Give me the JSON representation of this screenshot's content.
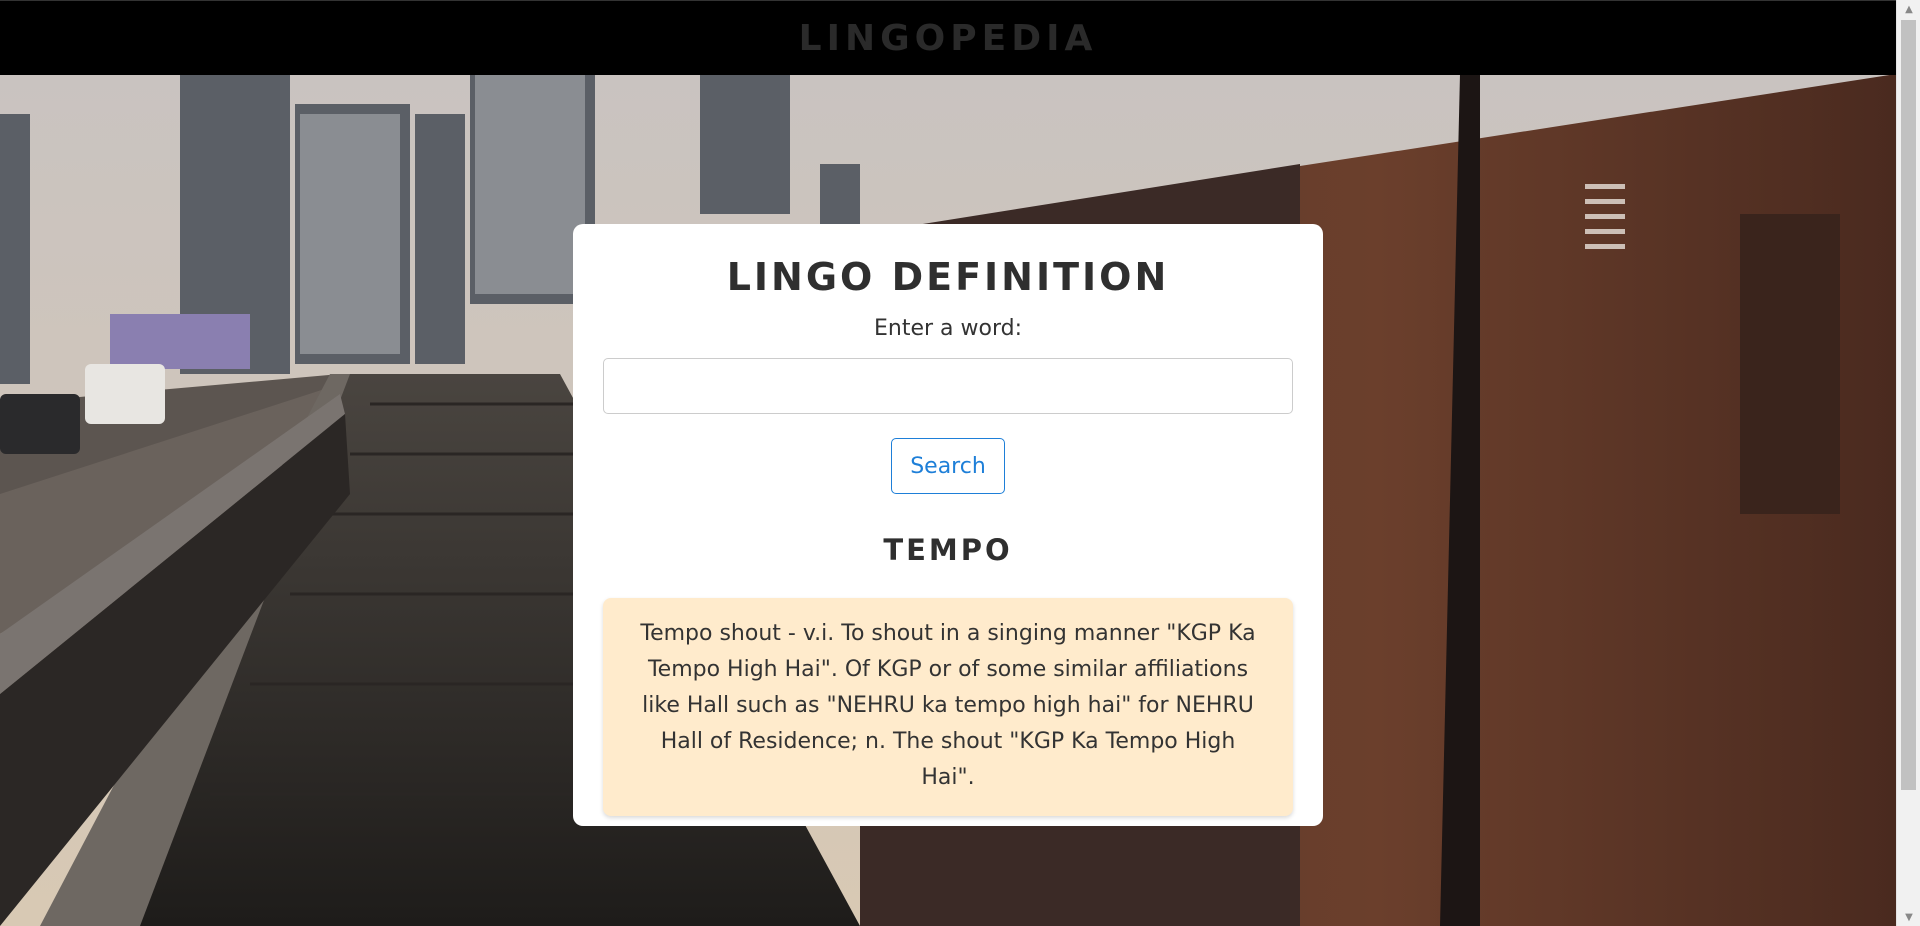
{
  "header": {
    "brand": "LINGOPEDIA"
  },
  "card": {
    "title": "LINGO DEFINITION",
    "input_label": "Enter a word:",
    "input_value": "",
    "search_label": "Search",
    "result_word": "TEMPO",
    "definition": "Tempo shout - v.i. To shout in a singing manner \"KGP Ka Tempo High Hai\". Of KGP or of some similar affiliations like Hall such as \"NEHRU ka tempo high hai\" for NEHRU Hall of Residence; n. The shout \"KGP Ka Tempo High Hai\"."
  },
  "colors": {
    "header_bg": "#000000",
    "brand_text": "#2a2a2a",
    "button_accent": "#1e7fd8",
    "definition_bg": "#ffebcc"
  },
  "icons": {
    "scroll_up": "triangle-up",
    "scroll_down": "triangle-down"
  }
}
